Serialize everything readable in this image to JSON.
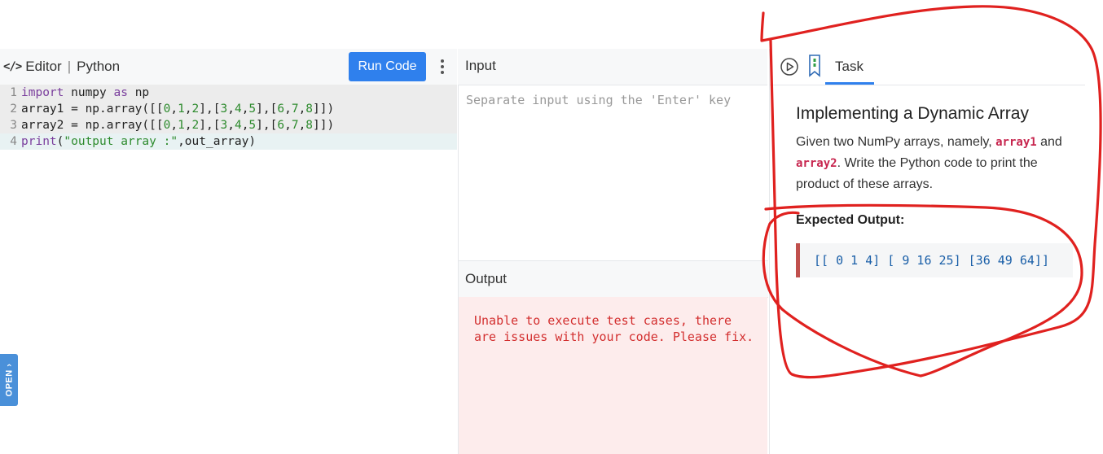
{
  "editor": {
    "icon": "code-icon",
    "title": "Editor",
    "separator": "|",
    "language": "Python",
    "run_label": "Run Code",
    "menu_icon": "kebab-menu-icon",
    "lines": [
      {
        "num": "1",
        "tokens": [
          [
            "kw",
            "import"
          ],
          [
            "code",
            " numpy "
          ],
          [
            "kw",
            "as"
          ],
          [
            "code",
            " np"
          ]
        ]
      },
      {
        "num": "2",
        "tokens": [
          [
            "code",
            "array1 = np.array([["
          ],
          [
            "num",
            "0"
          ],
          [
            "code",
            ","
          ],
          [
            "num",
            "1"
          ],
          [
            "code",
            ","
          ],
          [
            "num",
            "2"
          ],
          [
            "code",
            "],["
          ],
          [
            "num",
            "3"
          ],
          [
            "code",
            ","
          ],
          [
            "num",
            "4"
          ],
          [
            "code",
            ","
          ],
          [
            "num",
            "5"
          ],
          [
            "code",
            "],["
          ],
          [
            "num",
            "6"
          ],
          [
            "code",
            ","
          ],
          [
            "num",
            "7"
          ],
          [
            "code",
            ","
          ],
          [
            "num",
            "8"
          ],
          [
            "code",
            "]])"
          ]
        ]
      },
      {
        "num": "3",
        "tokens": [
          [
            "code",
            "array2 = np.array([["
          ],
          [
            "num",
            "0"
          ],
          [
            "code",
            ","
          ],
          [
            "num",
            "1"
          ],
          [
            "code",
            ","
          ],
          [
            "num",
            "2"
          ],
          [
            "code",
            "],["
          ],
          [
            "num",
            "3"
          ],
          [
            "code",
            ","
          ],
          [
            "num",
            "4"
          ],
          [
            "code",
            ","
          ],
          [
            "num",
            "5"
          ],
          [
            "code",
            "],["
          ],
          [
            "num",
            "6"
          ],
          [
            "code",
            ","
          ],
          [
            "num",
            "7"
          ],
          [
            "code",
            ","
          ],
          [
            "num",
            "8"
          ],
          [
            "code",
            "]])"
          ]
        ]
      },
      {
        "num": "4",
        "tokens": [
          [
            "kw",
            "print"
          ],
          [
            "code",
            "("
          ],
          [
            "str",
            "\"output array :\""
          ],
          [
            "code",
            ",out_array)"
          ]
        ]
      }
    ]
  },
  "input": {
    "title": "Input",
    "placeholder": "Separate input using the 'Enter' key"
  },
  "output": {
    "title": "Output",
    "message": "Unable to execute test cases, there are issues with your code. Please fix."
  },
  "task": {
    "tab_label": "Task",
    "title": "Implementing a Dynamic Array",
    "desc_before": "Given two NumPy arrays, namely, ",
    "code1": "array1",
    "desc_mid": " and ",
    "code2": "array2",
    "desc_after": ". Write the Python code to print the product of these arrays.",
    "expected_label": "Expected Output:",
    "expected_value": "[[ 0 1 4] [ 9 16 25] [36 49 64]]"
  },
  "side_tab": {
    "label": "OPEN",
    "icon": "chevron-right-icon"
  },
  "colors": {
    "accent": "#2f80ed",
    "error_text": "#d32f2f",
    "error_bg": "#fdecec",
    "annotation": "#e0211f"
  }
}
